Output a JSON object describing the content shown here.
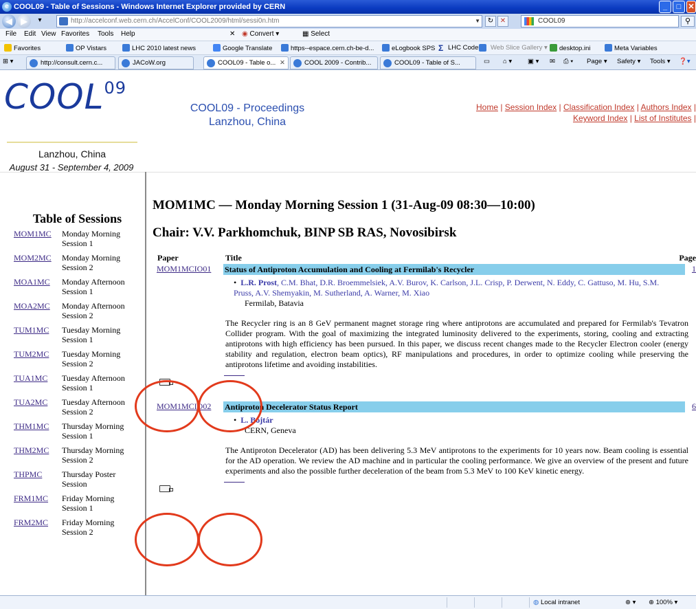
{
  "window": {
    "title": "COOL09 - Table of Sessions - Windows Internet Explorer provided by CERN",
    "url": "http://accelconf.web.cern.ch/AccelConf/COOL2009/html/sessi0n.htm",
    "search_value": "COOL09"
  },
  "menu": [
    "File",
    "Edit",
    "View",
    "Favorites",
    "Tools",
    "Help"
  ],
  "menu_tools": {
    "convert": "Convert",
    "select": "Select"
  },
  "favorites_bar": {
    "label": "Favorites",
    "items": [
      "OP Vistars",
      "LHC 2010 latest news",
      "Google Translate",
      "https--espace.cern.ch-be-d...",
      "eLogbook SPS",
      "LHC Codes",
      "Web Slice Gallery",
      "desktop.ini",
      "Meta Variables"
    ]
  },
  "tabs": [
    "http://consult.cern.c...",
    "JACoW.org",
    "COOL09 - Table o...",
    "COOL 2009 - Contrib...",
    "COOL09 - Table of S..."
  ],
  "command_bar": {
    "page": "Page",
    "safety": "Safety",
    "tools": "Tools"
  },
  "header": {
    "logo": "COOL",
    "logo_sup": "09",
    "location": "Lanzhou, China",
    "dates": "August 31 - September 4, 2009",
    "proceedings_title": "COOL09 - Proceedings",
    "proceedings_location": "Lanzhou, China",
    "links": [
      "Home",
      "Session Index",
      "Classification Index",
      "Authors Index",
      "Keyword Index",
      "List of Institutes"
    ]
  },
  "sidebar": {
    "title": "Table of Sessions",
    "sessions": [
      {
        "code": "MOM1MC",
        "name": "Monday Morning Session 1"
      },
      {
        "code": "MOM2MC",
        "name": "Monday Morning Session 2"
      },
      {
        "code": "MOA1MC",
        "name": "Monday Afternoon Session 1"
      },
      {
        "code": "MOA2MC",
        "name": "Monday Afternoon Session 2"
      },
      {
        "code": "TUM1MC",
        "name": "Tuesday Morning Session 1"
      },
      {
        "code": "TUM2MC",
        "name": "Tuesday Morning Session 2"
      },
      {
        "code": "TUA1MC",
        "name": "Tuesday Afternoon Session 1"
      },
      {
        "code": "TUA2MC",
        "name": "Tuesday Afternoon Session 2"
      },
      {
        "code": "THM1MC",
        "name": "Thursday Morning Session 1"
      },
      {
        "code": "THM2MC",
        "name": "Thursday Morning Session 2"
      },
      {
        "code": "THPMC",
        "name": "Thursday Poster Session"
      },
      {
        "code": "FRM1MC",
        "name": "Friday Morning Session 1"
      },
      {
        "code": "FRM2MC",
        "name": "Friday Morning Session 2"
      }
    ]
  },
  "main": {
    "session_heading": "MOM1MC — Monday Morning Session 1 (31-Aug-09 08:30—10:00)",
    "chair": "Chair: V.V. Parkhomchuk, BINP SB RAS, Novosibirsk",
    "columns": {
      "paper": "Paper",
      "title": "Title",
      "page": "Page"
    },
    "papers": [
      {
        "id": "MOM1MCIO01",
        "title": "Status of Antiproton Accumulation and Cooling at Fermilab's Recycler",
        "page": "1",
        "presenter": "L.R. Prost",
        "coauthors": ", C.M. Bhat, D.R. Broemmelsiek, A.V. Burov, K. Carlson, J.L. Crisp, P. Derwent, N. Eddy, C. Gattuso, M. Hu, S.M. Pruss, A.V. Shemyakin, M. Sutherland, A. Warner, M. Xiao",
        "institute": "Fermilab, Batavia",
        "abstract": "The Recycler ring is an 8 GeV permanent magnet storage ring where antiprotons are accumulated and prepared for Fermilab's Tevatron Collider program. With the goal of maximizing the integrated luminosity delivered to the experiments, storing, cooling and extracting antiprotons with high efficiency has been pursued. In this paper, we discuss recent changes made to the Recycler Electron cooler (energy stability and regulation, electron beam optics), RF manipulations and procedures, in order to optimize cooling while preserving the antiprotons lifetime and avoiding instabilities."
      },
      {
        "id": "MOM1MCIO02",
        "title": "Antiproton Decelerator Status Report",
        "page": "6",
        "presenter": "L. Bojtár",
        "coauthors": "",
        "institute": "CERN, Geneva",
        "abstract": "The Antiproton Decelerator (AD) has been delivering 5.3 MeV antiprotons to the experiments for 10 years now. Beam cooling is essential for the AD operation. We review the AD machine and in particular the cooling performance. We give an overview of the present and future experiments and also the possible further deceleration of the beam from 5.3 MeV to 100 KeV kinetic energy."
      }
    ]
  },
  "statusbar": {
    "zone": "Local intranet",
    "zoom": "100%"
  },
  "colors": {
    "accent": "#87ceeb",
    "link": "#3d2a86",
    "annotation": "#e23a1c",
    "background": "#0a1f8a"
  }
}
